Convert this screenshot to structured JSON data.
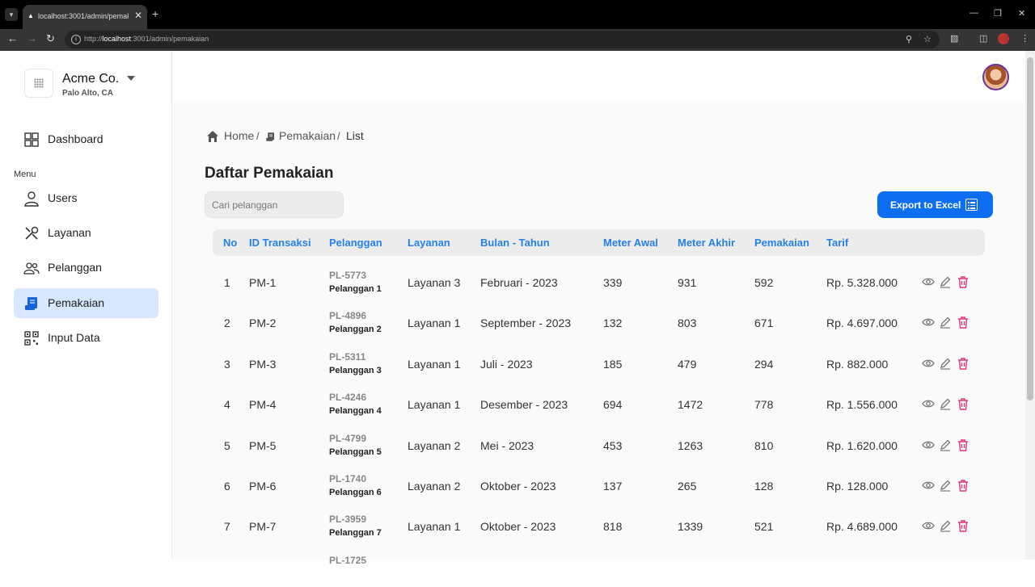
{
  "browser": {
    "tab_title": "localhost:3001/admin/pemakaian",
    "url_prefix": "http://",
    "url_host": "localhost",
    "url_rest": ":3001/admin/pemakaian"
  },
  "org": {
    "name": "Acme Co.",
    "location": "Palo Alto, CA"
  },
  "sidebar": {
    "dashboard": "Dashboard",
    "menu_heading": "Menu",
    "items": [
      {
        "label": "Users",
        "icon": "user-icon"
      },
      {
        "label": "Layanan",
        "icon": "tools-icon"
      },
      {
        "label": "Pelanggan",
        "icon": "users-icon"
      },
      {
        "label": "Pemakaian",
        "icon": "document-icon",
        "active": true
      },
      {
        "label": "Input Data",
        "icon": "qr-code-icon"
      }
    ]
  },
  "breadcrumb": {
    "home": "Home",
    "section": "Pemakaian",
    "current": "List",
    "sep": "/"
  },
  "page": {
    "title": "Daftar Pemakaian",
    "search_placeholder": "Cari pelanggan",
    "export_label": "Export to Excel"
  },
  "table": {
    "headers": [
      "No",
      "ID Transaksi",
      "Pelanggan",
      "Layanan",
      "Bulan - Tahun",
      "Meter Awal",
      "Meter Akhir",
      "Pemakaian",
      "Tarif"
    ],
    "rows": [
      {
        "no": "1",
        "id": "PM-1",
        "cust_id": "PL-5773",
        "cust_name": "Pelanggan 1",
        "layanan": "Layanan 3",
        "periode": "Februari - 2023",
        "awal": "339",
        "akhir": "931",
        "pemakaian": "592",
        "tarif": "Rp. 5.328.000"
      },
      {
        "no": "2",
        "id": "PM-2",
        "cust_id": "PL-4896",
        "cust_name": "Pelanggan 2",
        "layanan": "Layanan 1",
        "periode": "September - 2023",
        "awal": "132",
        "akhir": "803",
        "pemakaian": "671",
        "tarif": "Rp. 4.697.000"
      },
      {
        "no": "3",
        "id": "PM-3",
        "cust_id": "PL-5311",
        "cust_name": "Pelanggan 3",
        "layanan": "Layanan 1",
        "periode": "Juli - 2023",
        "awal": "185",
        "akhir": "479",
        "pemakaian": "294",
        "tarif": "Rp. 882.000"
      },
      {
        "no": "4",
        "id": "PM-4",
        "cust_id": "PL-4246",
        "cust_name": "Pelanggan 4",
        "layanan": "Layanan 1",
        "periode": "Desember - 2023",
        "awal": "694",
        "akhir": "1472",
        "pemakaian": "778",
        "tarif": "Rp. 1.556.000"
      },
      {
        "no": "5",
        "id": "PM-5",
        "cust_id": "PL-4799",
        "cust_name": "Pelanggan 5",
        "layanan": "Layanan 2",
        "periode": "Mei - 2023",
        "awal": "453",
        "akhir": "1263",
        "pemakaian": "810",
        "tarif": "Rp. 1.620.000"
      },
      {
        "no": "6",
        "id": "PM-6",
        "cust_id": "PL-1740",
        "cust_name": "Pelanggan 6",
        "layanan": "Layanan 2",
        "periode": "Oktober - 2023",
        "awal": "137",
        "akhir": "265",
        "pemakaian": "128",
        "tarif": "Rp. 128.000"
      },
      {
        "no": "7",
        "id": "PM-7",
        "cust_id": "PL-3959",
        "cust_name": "Pelanggan 7",
        "layanan": "Layanan 1",
        "periode": "Oktober - 2023",
        "awal": "818",
        "akhir": "1339",
        "pemakaian": "521",
        "tarif": "Rp. 4.689.000"
      },
      {
        "no": "",
        "id": "",
        "cust_id": "PL-1725",
        "cust_name": "",
        "layanan": "",
        "periode": "",
        "awal": "",
        "akhir": "",
        "pemakaian": "",
        "tarif": ""
      }
    ]
  },
  "colors": {
    "accent": "#2680eb",
    "button": "#0d6ef2",
    "active_nav": "#d6e7ff",
    "delete": "#e0347a"
  }
}
